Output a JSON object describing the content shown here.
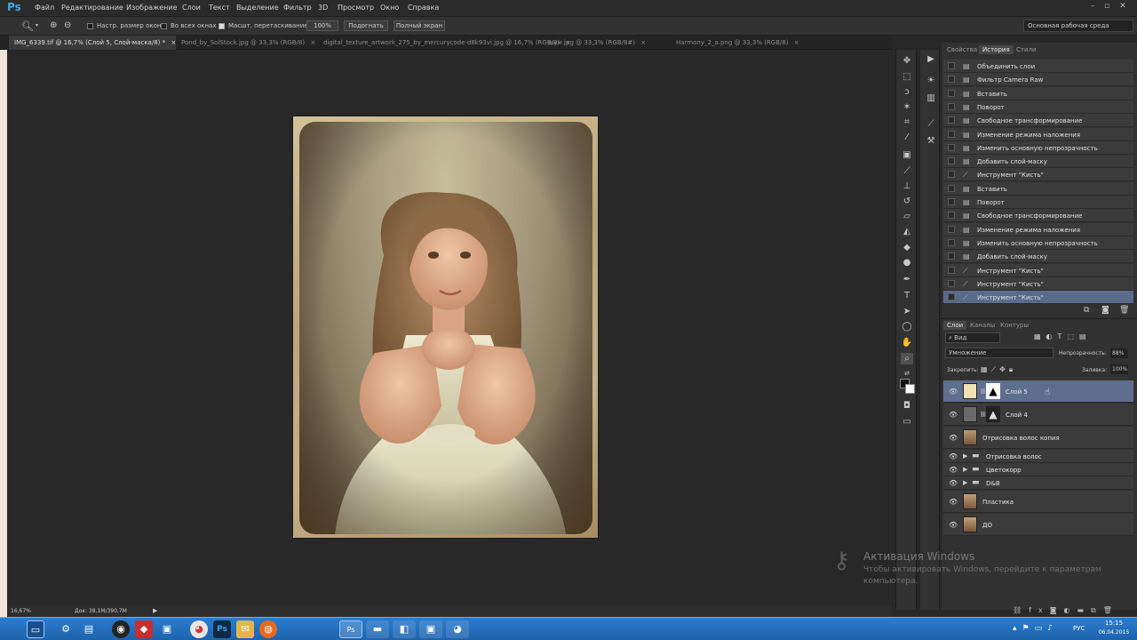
{
  "app": {
    "logo": "Ps"
  },
  "menu": {
    "items": [
      "Файл",
      "Редактирование",
      "Изображение",
      "Слои",
      "Текст",
      "Выделение",
      "Фильтр",
      "3D",
      "Просмотр",
      "Окно",
      "Справка"
    ]
  },
  "window_controls": [
    "minimize-icon",
    "restore-icon",
    "close-icon"
  ],
  "options": {
    "fit_label": "Настр. размер окон",
    "all_windows_label": "Во всех окнах",
    "scrubby_label": "Масшт. перетаскиванием",
    "zoom_value": "100%",
    "fit_button": "Подогнать",
    "fullscreen_button": "Полный экран",
    "workspace": "Основная рабочая среда"
  },
  "tabs": [
    {
      "label": "IMG_6339.tif @ 16,7% (Слой 5, Слой-маска/8) *"
    },
    {
      "label": "Pond_by_SolStock.jpg @ 33,3% (RGB/8)"
    },
    {
      "label": "digital_texture_artwork_275_by_mercurycode-d8k93vi.jpg @ 16,7% (RGB/8)"
    },
    {
      "label": "шум.jpg @ 33,3% (RGB/8#)"
    },
    {
      "label": "Harmony_2_a.png @ 33,3% (RGB/8)"
    }
  ],
  "status": {
    "zoom": "16,67%",
    "doc": "Док: 38,1M/390,7M"
  },
  "history_panel": {
    "tabs": [
      "Свойства",
      "История",
      "Стили"
    ],
    "items": [
      "Объединить слои",
      "Фильтр Camera Raw",
      "Вставить",
      "Поворот",
      "Свободное трансформирование",
      "Изменение режима наложения",
      "Изменить основную непрозрачность",
      "Добавить слой-маску",
      "Инструмент \"Кисть\"",
      "Вставить",
      "Поворот",
      "Свободное трансформирование",
      "Изменение режима наложения",
      "Изменить основную непрозрачность",
      "Добавить слой-маску",
      "Инструмент \"Кисть\"",
      "Инструмент \"Кисть\"",
      "Инструмент \"Кисть\""
    ]
  },
  "layers_panel": {
    "tabs": [
      "Слои",
      "Каналы",
      "Контуры"
    ],
    "filter": "Вид",
    "blend_mode": "Умножение",
    "opacity_label": "Непрозрачность:",
    "opacity_value": "88%",
    "lock_label": "Закрепить:",
    "fill_label": "Заливка:",
    "fill_value": "100%",
    "layers": [
      {
        "name": "Слой 5"
      },
      {
        "name": "Слой 4"
      },
      {
        "name": "Отрисовка волос копия"
      },
      {
        "name": "Отрисовка волос"
      },
      {
        "name": "Цветокорр"
      },
      {
        "name": "D&B"
      },
      {
        "name": "Пластика"
      },
      {
        "name": "ДО"
      }
    ]
  },
  "activation": {
    "title": "Активация Windows",
    "line1": "Чтобы активировать Windows, перейдите к параметрам",
    "line2": "компьютера."
  },
  "taskbar": {
    "lang": "РУС",
    "time": "15:15",
    "date": "06.04.2015"
  },
  "colors": {
    "accent": "#3ea4e8",
    "selection": "#5e6f8e",
    "taskbar": "#2a7dd1"
  }
}
